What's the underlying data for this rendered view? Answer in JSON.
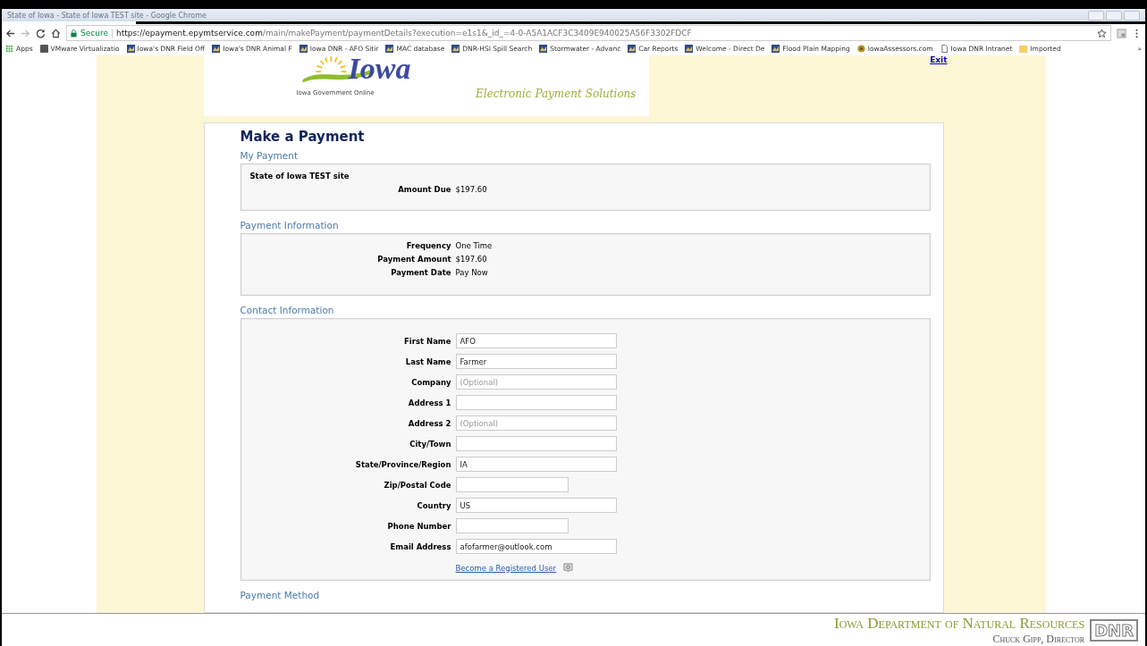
{
  "window": {
    "title": "State of Iowa - State of Iowa TEST site - Google Chrome"
  },
  "toolbar": {
    "secure_label": "Secure",
    "url_host": "https://epayment.epymtservice.com",
    "url_path": "/main/makePayment/paymentDetails?execution=e1s1&_id_=4-0-A5A1ACF3C3409E940025A56F3302FDCF",
    "forward_disabled": true
  },
  "bookmarks": [
    {
      "label": "Apps",
      "kind": "apps"
    },
    {
      "label": "VMware Virtualizatio",
      "kind": "vm"
    },
    {
      "label": "Iowa's DNR Field Off",
      "kind": "site"
    },
    {
      "label": "Iowa's DNR Animal F",
      "kind": "site"
    },
    {
      "label": "Iowa DNR - AFO Sitir",
      "kind": "site"
    },
    {
      "label": "MAC database",
      "kind": "site"
    },
    {
      "label": "DNR-HSI Spill Search",
      "kind": "site"
    },
    {
      "label": "Stormwater - Advanc",
      "kind": "site"
    },
    {
      "label": "Car Reports",
      "kind": "site"
    },
    {
      "label": "Welcome - Direct De",
      "kind": "site"
    },
    {
      "label": "Flood Plain Mapping",
      "kind": "site"
    },
    {
      "label": "IowaAssessors.com",
      "kind": "globe"
    },
    {
      "label": "Iowa DNR Intranet",
      "kind": "page"
    },
    {
      "label": "Imported",
      "kind": "folder"
    }
  ],
  "bookmarks_more": "»",
  "header": {
    "logo_text": "Iowa",
    "logo_caption": "Iowa Government Online",
    "tagline": "Electronic Payment Solutions",
    "exit_link": "Exit"
  },
  "page_title": "Make a Payment",
  "my_payment": {
    "heading": "My Payment",
    "site_name": "State of Iowa TEST site",
    "rows": [
      {
        "label": "Amount Due",
        "value": "$197.60"
      }
    ]
  },
  "payment_information": {
    "heading": "Payment Information",
    "rows": [
      {
        "label": "Frequency",
        "value": "One Time"
      },
      {
        "label": "Payment Amount",
        "value": "$197.60"
      },
      {
        "label": "Payment Date",
        "value": "Pay Now"
      }
    ]
  },
  "contact_information": {
    "heading": "Contact Information",
    "fields": [
      {
        "label": "First Name",
        "value": "AFO",
        "kind": "long"
      },
      {
        "label": "Last Name",
        "value": "Farmer",
        "kind": "long"
      },
      {
        "label": "Company",
        "placeholder": "(Optional)",
        "kind": "long"
      },
      {
        "label": "Address 1",
        "kind": "long"
      },
      {
        "label": "Address 2",
        "placeholder": "(Optional)",
        "kind": "long"
      },
      {
        "label": "City/Town",
        "kind": "long"
      },
      {
        "label": "State/Province/Region",
        "value": "IA",
        "kind": "long"
      },
      {
        "label": "Zip/Postal Code",
        "kind": "short"
      },
      {
        "label": "Country",
        "value": "US",
        "kind": "long"
      },
      {
        "label": "Phone Number",
        "kind": "short"
      },
      {
        "label": "Email Address",
        "value": "afofarmer@outlook.com",
        "kind": "long"
      }
    ],
    "register_link": "Become a Registered User"
  },
  "next_section_heading": "Payment Method",
  "footer": {
    "department": "Iowa Department of Natural Resources",
    "director": "Chuck Gipp, Director",
    "logo_text": "DNR"
  }
}
